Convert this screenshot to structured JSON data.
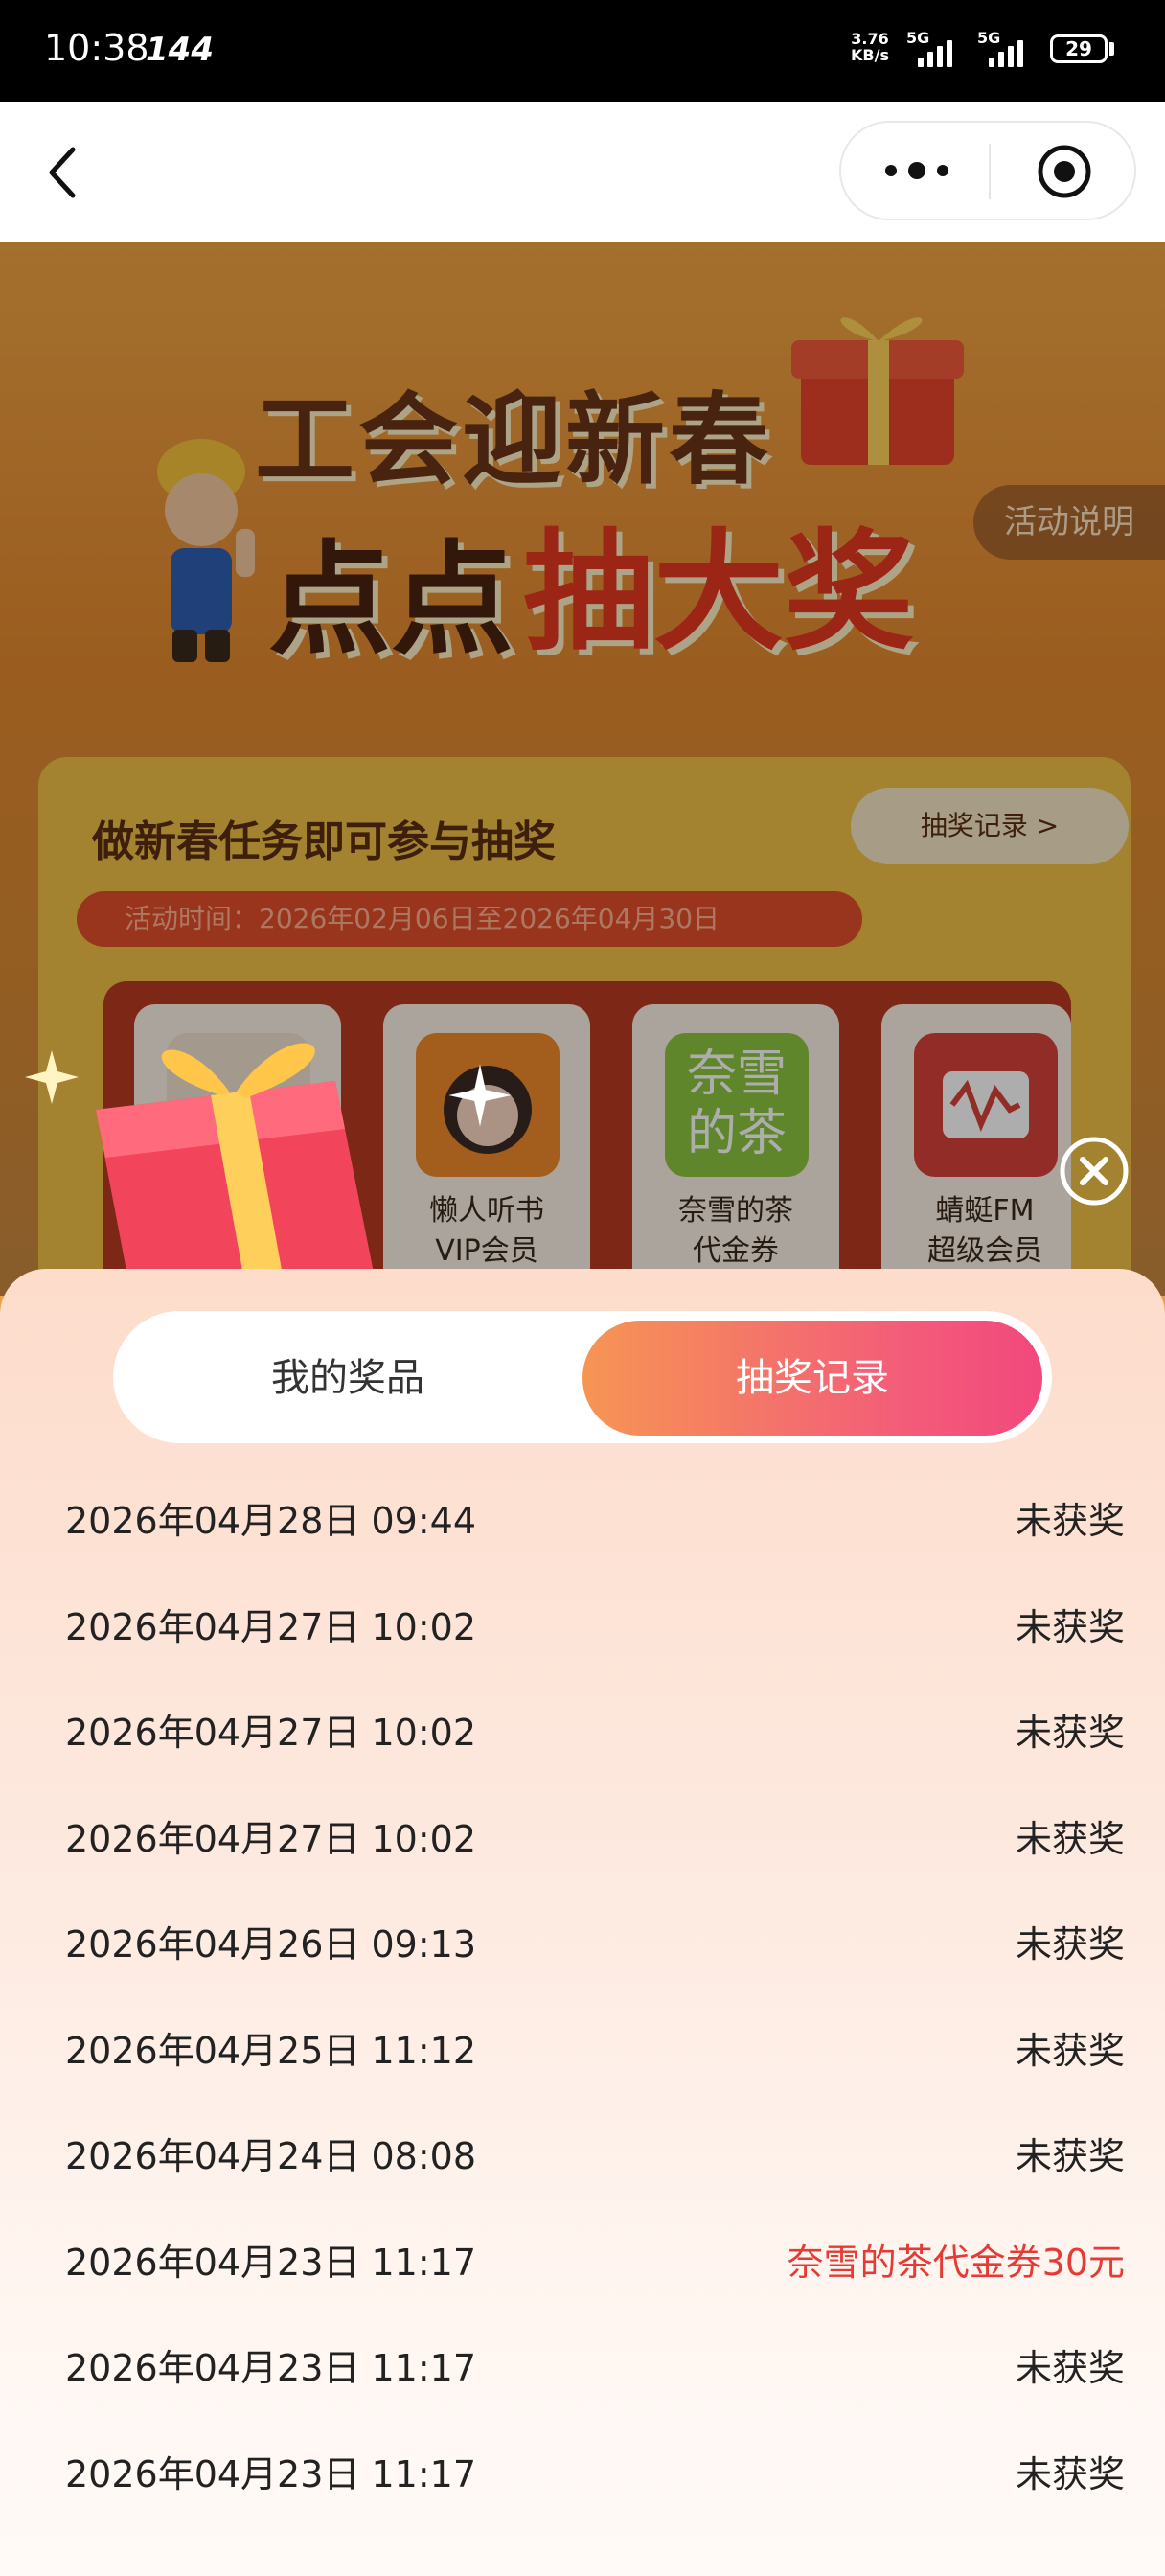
{
  "status_bar": {
    "time": "10:38",
    "refresh_rate": "144",
    "net_speed_value": "3.76",
    "net_speed_unit": "KB/s",
    "sim1": "5G",
    "sim2": "5G",
    "battery": "29"
  },
  "nav": {
    "back_icon": "chevron-left-icon",
    "more_icon": "more-dots-icon",
    "close_mini_icon": "target-icon"
  },
  "activity": {
    "title_line1": "工会迎新春",
    "title_line2_a": "点点",
    "title_line2_b": "抽大奖",
    "explain_button": "活动说明",
    "task_title": "做新春任务即可参与抽奖",
    "record_link": "抽奖记录 >",
    "time_range": "活动时间：2026年02月06日至2026年04月30日",
    "prizes": [
      {
        "name": "懒人听书",
        "sub": "VIP会员"
      },
      {
        "name": "奈雪的茶",
        "sub": "代金券"
      },
      {
        "name": "蜻蜓FM",
        "sub": "超级会员"
      }
    ],
    "naixue_logo_text": "奈雪的茶"
  },
  "sheet": {
    "tabs": [
      {
        "label": "我的奖品",
        "active": false
      },
      {
        "label": "抽奖记录",
        "active": true
      }
    ],
    "records": [
      {
        "datetime": "2026年04月28日 09:44",
        "result": "未获奖",
        "won": false
      },
      {
        "datetime": "2026年04月27日 10:02",
        "result": "未获奖",
        "won": false
      },
      {
        "datetime": "2026年04月27日 10:02",
        "result": "未获奖",
        "won": false
      },
      {
        "datetime": "2026年04月27日 10:02",
        "result": "未获奖",
        "won": false
      },
      {
        "datetime": "2026年04月26日 09:13",
        "result": "未获奖",
        "won": false
      },
      {
        "datetime": "2026年04月25日 11:12",
        "result": "未获奖",
        "won": false
      },
      {
        "datetime": "2026年04月24日 08:08",
        "result": "未获奖",
        "won": false
      },
      {
        "datetime": "2026年04月23日 11:17",
        "result": "奈雪的茶代金券30元",
        "won": true
      },
      {
        "datetime": "2026年04月23日 11:17",
        "result": "未获奖",
        "won": false
      },
      {
        "datetime": "2026年04月23日 11:17",
        "result": "未获奖",
        "won": false
      }
    ]
  },
  "colors": {
    "accent_gradient_start": "#f69554",
    "accent_gradient_end": "#f2487d",
    "win_text": "#e53a35"
  }
}
